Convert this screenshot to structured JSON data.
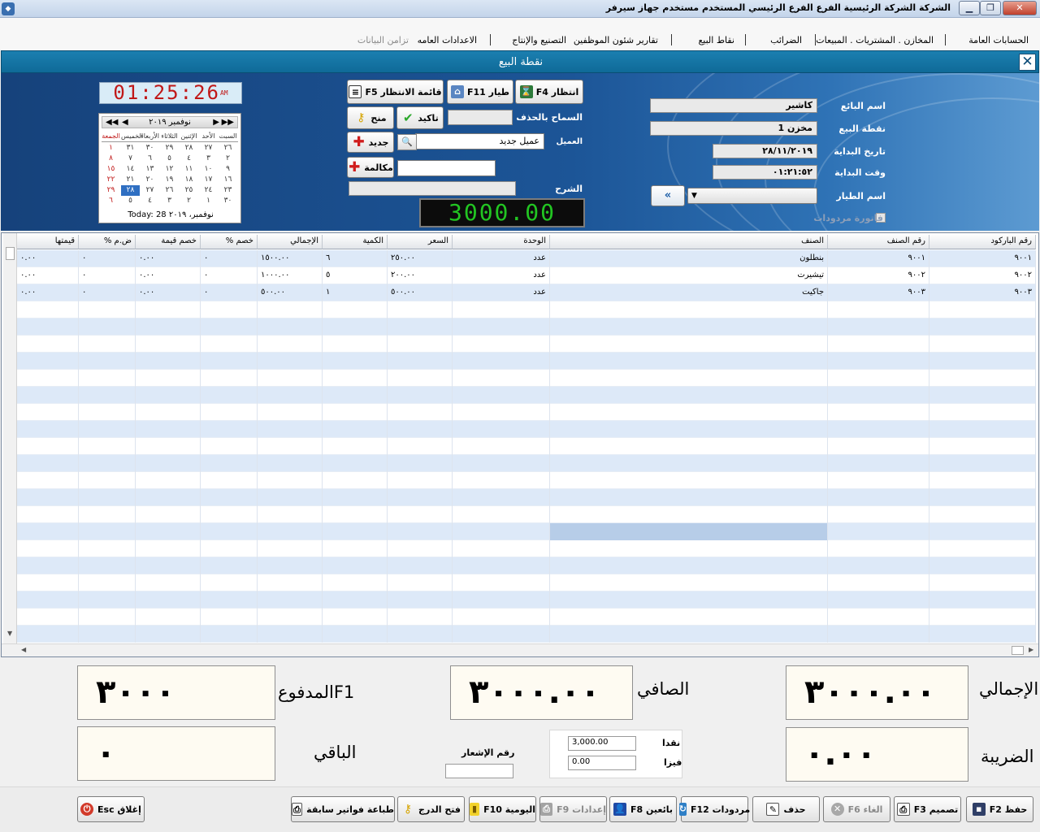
{
  "window": {
    "title": "الشركة الشركة الرئيسية   الفرع الفرع الرئيسي   المستخدم مستخدم   جهاز سيرفر",
    "min": "▁",
    "max": "❐",
    "close": "✕"
  },
  "menu": [
    "الحسابات العامة",
    "المخازن . المشتريات . المبيعات",
    "الضرائب",
    "نقاط البيع",
    "تقارير شئون الموظفين",
    "التصنيع والإنتاج",
    "الاعدادات العامه",
    "تزامن البيانات"
  ],
  "dialog": {
    "title": "نقطة البيع",
    "close": "✕"
  },
  "form": {
    "seller_label": "اسم البائع",
    "seller_value": "كاشير",
    "pos_label": "نقطة البيع",
    "pos_value": "مخزن 1",
    "start_date_label": "تاريخ البداية",
    "start_date_value": "٢٨/١١/٢٠١٩",
    "start_time_label": "وقت البداية",
    "start_time_value": "٠١:٢١:٥٢",
    "waiter_label": "اسم الطيار",
    "returns_label": "فاتورة مردودات",
    "allow_delete_label": "السماح بالحذف",
    "customer_label": "العميل",
    "customer_value": "عميل جديد",
    "description_label": "الشرح",
    "buttons": {
      "wait": "انتظار F4",
      "pilot": "طيار F11",
      "wait_list": "قائمة الانتظار F5",
      "confirm": "تاكيد",
      "grant": "منح",
      "new": "جديد",
      "call": "مكالمة"
    },
    "arrow": "«",
    "digital_total": "3000.00"
  },
  "clock": {
    "time": "01:25:26",
    "ampm": "AM"
  },
  "calendar": {
    "month": "نوفمبر ٢٠١٩",
    "nav": [
      "◀◀",
      "◀",
      "▶",
      "▶▶"
    ],
    "days": [
      "السبت",
      "الأحد",
      "الإثنين",
      "الثلاثاء",
      "الأربعاء",
      "الخميس",
      "الجمعة"
    ],
    "weeks": [
      [
        "٢٦",
        "٢٧",
        "٢٨",
        "٢٩",
        "٣٠",
        "٣١",
        "١"
      ],
      [
        "٢",
        "٣",
        "٤",
        "٥",
        "٦",
        "٧",
        "٨"
      ],
      [
        "٩",
        "١٠",
        "١١",
        "١٢",
        "١٣",
        "١٤",
        "١٥"
      ],
      [
        "١٦",
        "١٧",
        "١٨",
        "١٩",
        "٢٠",
        "٢١",
        "٢٢"
      ],
      [
        "٢٣",
        "٢٤",
        "٢٥",
        "٢٦",
        "٢٧",
        "٢٨",
        "٢٩"
      ],
      [
        "٣٠",
        "١",
        "٢",
        "٣",
        "٤",
        "٥",
        "٦"
      ]
    ],
    "today_label": "Today: 28 نوفمبر، ٢٠١٩"
  },
  "grid": {
    "headers": [
      "رقم الباركود",
      "رقم الصنف",
      "الصنف",
      "الوحدة",
      "السعر",
      "الكمية",
      "الإجمالي",
      "خصم %",
      "خصم قيمة",
      "ض.م %",
      "قيمتها"
    ],
    "rows": [
      [
        "٩٠٠١",
        "٩٠٠١",
        "بنطلون",
        "عدد",
        "٢٥٠.٠٠",
        "٦",
        "١٥٠٠.٠٠",
        "٠",
        "٠.٠٠",
        "٠",
        "٠.٠٠"
      ],
      [
        "٩٠٠٢",
        "٩٠٠٢",
        "تيشيرت",
        "عدد",
        "٢٠٠.٠٠",
        "٥",
        "١٠٠٠.٠٠",
        "٠",
        "٠.٠٠",
        "٠",
        "٠.٠٠"
      ],
      [
        "٩٠٠٣",
        "٩٠٠٣",
        "جاكيت",
        "عدد",
        "٥٠٠.٠٠",
        "١",
        "٥٠٠.٠٠",
        "٠",
        "٠.٠٠",
        "٠",
        "٠.٠٠"
      ]
    ]
  },
  "totals": {
    "total_label": "الإجمالي",
    "total_value": "٣٠٠٠.٠٠",
    "net_label": "الصافي",
    "net_value": "٣٠٠٠.٠٠",
    "paid_label": "المدفوعF1",
    "paid_value": "٣٠٠٠",
    "tax_label": "الضريبة",
    "tax_value": "٠.٠٠",
    "remaining_label": "الباقي",
    "remaining_value": "٠",
    "notice_label": "رقم الإشعار",
    "cash_label": "نقدا",
    "cash_value": "3,000.00",
    "visa_label": "فيزا",
    "visa_value": "0.00"
  },
  "bottom_buttons": {
    "save": "حفظ F2",
    "design": "تصميم F3",
    "cancel": "الغاء F6",
    "delete": "حذف",
    "returns": "مردودات F12",
    "sellers": "بائعين F8",
    "settings": "إعدادات F9",
    "daily": "اليومية F10",
    "open_drawer": "فتح الدرج",
    "print_prev": "طباعة فواتير سابقة",
    "close": "إغلاق Esc"
  }
}
